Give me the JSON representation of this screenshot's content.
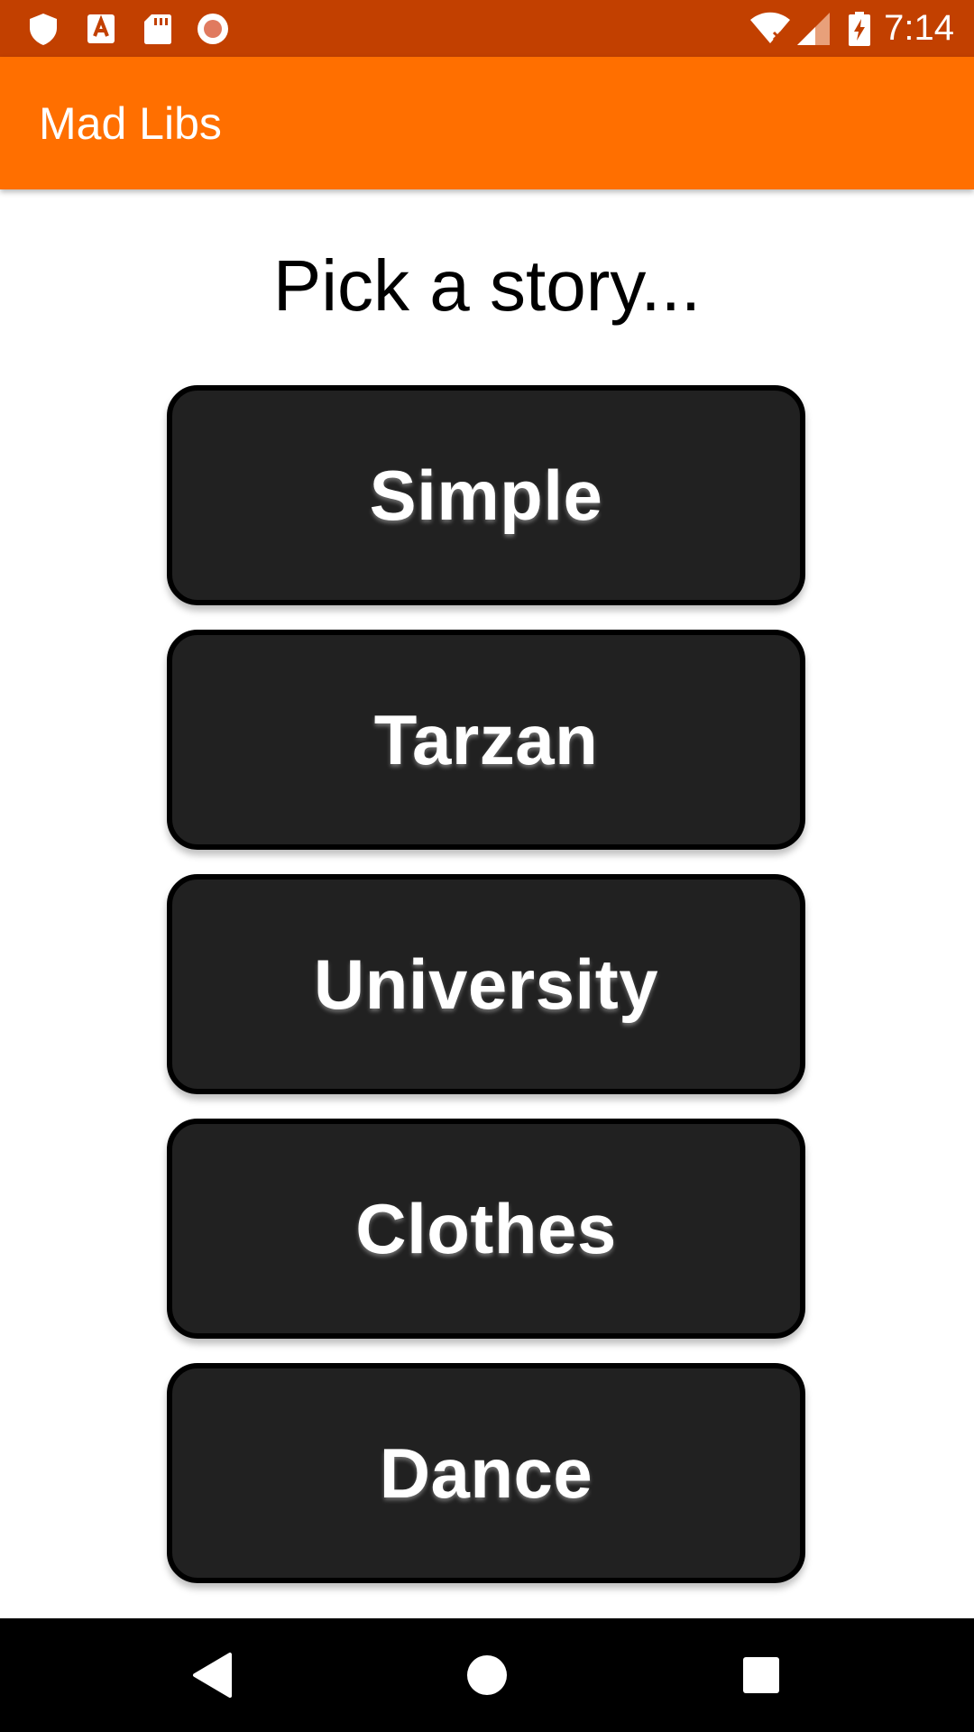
{
  "status_bar": {
    "time": "7:14",
    "icons": [
      "shield-icon",
      "font-a-icon",
      "sd-card-icon",
      "record-icon",
      "wifi-off-icon",
      "signal-icon",
      "battery-charging-icon"
    ],
    "background": "#c24000"
  },
  "app_bar": {
    "title": "Mad Libs",
    "background": "#ff6f00"
  },
  "main": {
    "heading": "Pick a story...",
    "stories": [
      {
        "label": "Simple"
      },
      {
        "label": "Tarzan"
      },
      {
        "label": "University"
      },
      {
        "label": "Clothes"
      },
      {
        "label": "Dance"
      }
    ],
    "button_color": "#212121"
  },
  "nav_bar": {
    "buttons": [
      "back-icon",
      "home-icon",
      "recents-icon"
    ]
  }
}
